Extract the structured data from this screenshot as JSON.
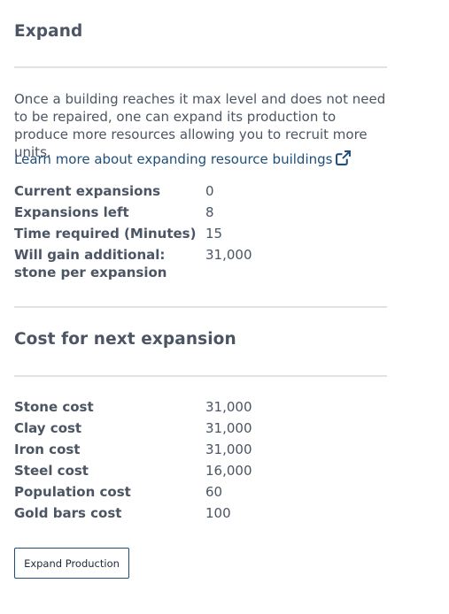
{
  "expand": {
    "title": "Expand",
    "description": "Once a building reaches it max level and does not need to be repaired, one can expand its production to produce more resources allowing you to recruit more units.",
    "learn_more": "Learn more about expanding resource buildings",
    "link_icon": "external-link-icon",
    "link_color": "#1f4e79",
    "stats": [
      {
        "label": "Current expansions",
        "value": "0"
      },
      {
        "label": "Expansions left",
        "value": "8"
      },
      {
        "label": "Time required (Minutes)",
        "value": "15"
      },
      {
        "label": "Will gain additional: stone per expansion",
        "value": "31,000"
      }
    ]
  },
  "cost": {
    "title": "Cost for next expansion",
    "items": [
      {
        "label": "Stone cost",
        "value": "31,000"
      },
      {
        "label": "Clay cost",
        "value": "31,000"
      },
      {
        "label": "Iron cost",
        "value": "31,000"
      },
      {
        "label": "Steel cost",
        "value": "16,000"
      },
      {
        "label": "Population cost",
        "value": "60"
      },
      {
        "label": "Gold bars cost",
        "value": "100"
      }
    ]
  },
  "actions": {
    "expand_button": "Expand Production"
  }
}
